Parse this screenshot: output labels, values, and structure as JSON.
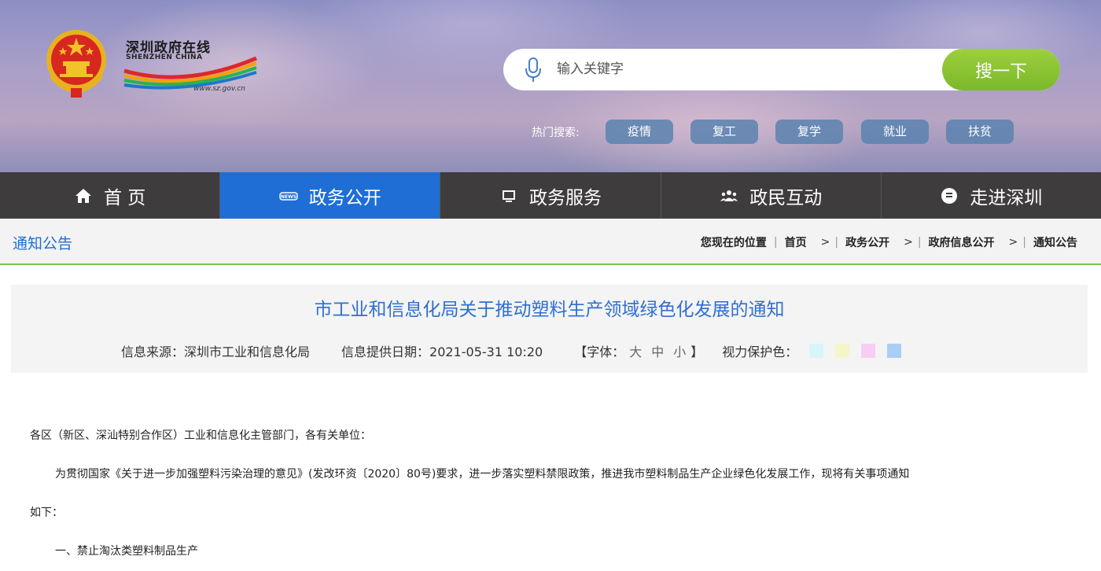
{
  "header": {
    "logo_cn": "深圳政府在线",
    "logo_en": "SHENZHEN CHINA",
    "logo_url": "www.sz.gov.cn",
    "search": {
      "placeholder": "输入关键字",
      "button_label": "搜一下"
    },
    "hot_label": "热门搜索:",
    "hot_tags": [
      "疫情",
      "复工",
      "复学",
      "就业",
      "扶贫"
    ]
  },
  "nav": {
    "items": [
      {
        "label": "首 页",
        "icon": "home-icon"
      },
      {
        "label": "政务公开",
        "icon": "news-icon",
        "active": true
      },
      {
        "label": "政务服务",
        "icon": "monitor-icon"
      },
      {
        "label": "政民互动",
        "icon": "users-icon"
      },
      {
        "label": "走进深圳",
        "icon": "info-bubble-icon"
      }
    ]
  },
  "breadcrumb": {
    "section": "通知公告",
    "prefix": "您现在的位置",
    "items": [
      "首页",
      "政务公开",
      "政府信息公开",
      "通知公告"
    ]
  },
  "article": {
    "title": "市工业和信息化局关于推动塑料生产领域绿色化发展的通知",
    "source": "信息来源：深圳市工业和信息化局",
    "date": "信息提供日期：2021-05-31 10:20",
    "font_open": "【字体：",
    "font_large": "大",
    "font_medium": "中",
    "font_small": "小",
    "font_close": "】",
    "eye_label": "视力保护色：",
    "eye_colors": [
      "#d6f6fb",
      "#f5f5c8",
      "#f8cdf4",
      "#a9cdf6"
    ],
    "paragraphs": [
      "各区（新区、深汕特别合作区）工业和信息化主管部门，各有关单位：",
      "为贯彻国家《关于进一步加强塑料污染治理的意见》(发改环资〔2020〕80号)要求，进一步落实塑料禁限政策，推进我市塑料制品生产企业绿色化发展工作，现将有关事项通知",
      "如下：",
      "一、禁止淘汰类塑料制品生产"
    ]
  },
  "colors": {
    "nav_bg": "#3f3c3e",
    "nav_active": "#1f6ed6",
    "title_blue": "#2f6fd0",
    "search_green": "#8cc535",
    "divider_green": "#7fc251"
  }
}
